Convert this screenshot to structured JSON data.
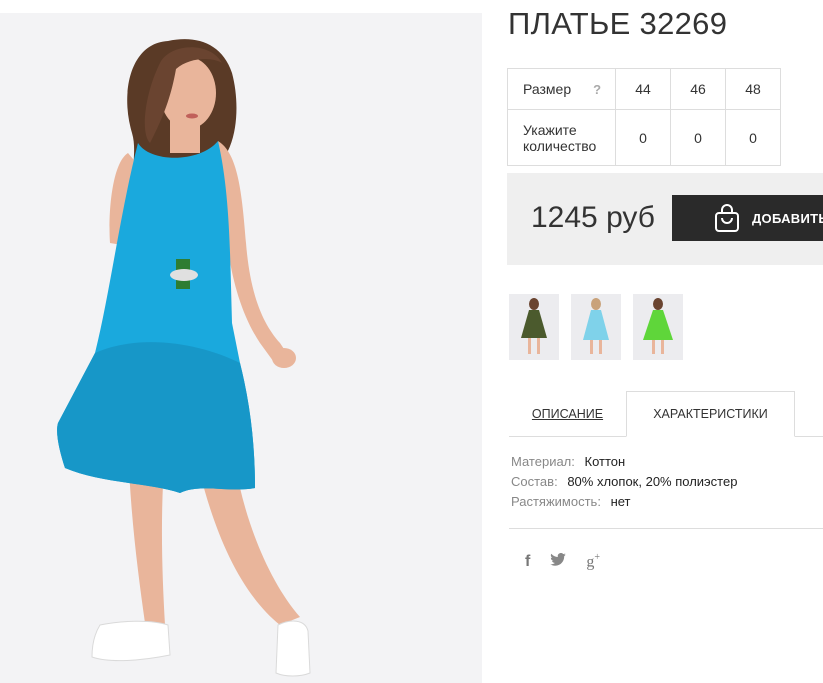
{
  "product": {
    "title": "ПЛАТЬЕ 32269",
    "colors": {
      "dress": "#1aa9dd",
      "skin": "#e9b59b",
      "hair": "#5a3a26",
      "button": "#2a2a2a",
      "buybox": "#efefef"
    }
  },
  "size_table": {
    "size_label": "Размер",
    "help_icon": "?",
    "sizes": [
      "44",
      "46",
      "48"
    ],
    "qty_label_line1": "Укажите",
    "qty_label_line2": "количество",
    "quantities": [
      "0",
      "0",
      "0"
    ]
  },
  "buy": {
    "price": "1245 руб",
    "add_label": "ДОБАВИТЬ",
    "icon": "shopping-bag-icon"
  },
  "thumbnails": [
    {
      "name": "olive",
      "dress_color": "#4b5a2d"
    },
    {
      "name": "light-blue",
      "dress_color": "#7fd2ea"
    },
    {
      "name": "green",
      "dress_color": "#5fd63a"
    }
  ],
  "tabs": {
    "description": "ОПИСАНИЕ",
    "characteristics": "ХАРАКТЕРИСТИКИ"
  },
  "specs": [
    {
      "key": "Материал:",
      "value": "Коттон"
    },
    {
      "key": "Состав:",
      "value": "80% хлопок, 20% полиэстер"
    },
    {
      "key": "Растяжимость:",
      "value": "нет"
    }
  ],
  "social": {
    "facebook": "f",
    "twitter": "twitter-icon",
    "googleplus": "g",
    "googleplus_sup": "+"
  }
}
